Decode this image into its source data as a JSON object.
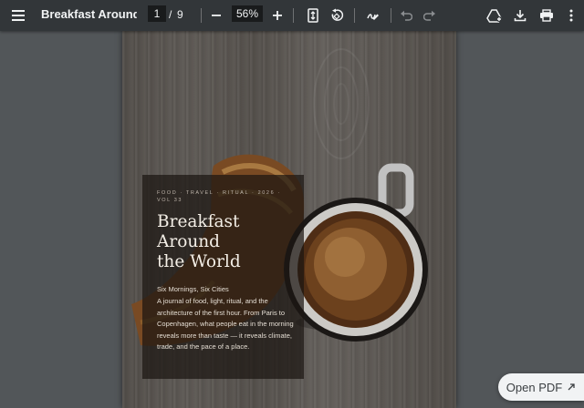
{
  "toolbar": {
    "menu_icon": "hamburger-menu-icon",
    "title": "Breakfast Around ...",
    "current_page": "1",
    "page_separator": "/",
    "total_pages": "9",
    "zoom_level": "56%",
    "icons": [
      "zoom-out-icon",
      "zoom-in-icon",
      "fit-page-icon",
      "rotate-icon",
      "annotate-pen-icon",
      "undo-icon",
      "redo-icon",
      "drive-save-icon",
      "download-icon",
      "print-icon",
      "more-options-icon"
    ]
  },
  "document": {
    "tagline": "FOOD · TRAVEL · RITUAL · 2026 · VOL 33",
    "title": "Breakfast\nAround\nthe World",
    "subheading": "Six Mornings, Six Cities",
    "description": "A journal of food, light, ritual, and the architecture of the first hour. From Paris to Copenhagen, what people eat in the morning reveals more than taste — it reveals climate, trade, and the pace of a place."
  },
  "open_pdf": {
    "label": "Open PDF",
    "icon": "external-link-icon"
  },
  "colors": {
    "toolbar_bg": "#323639",
    "viewer_bg": "#525659",
    "text_light": "#f1f3f4"
  }
}
